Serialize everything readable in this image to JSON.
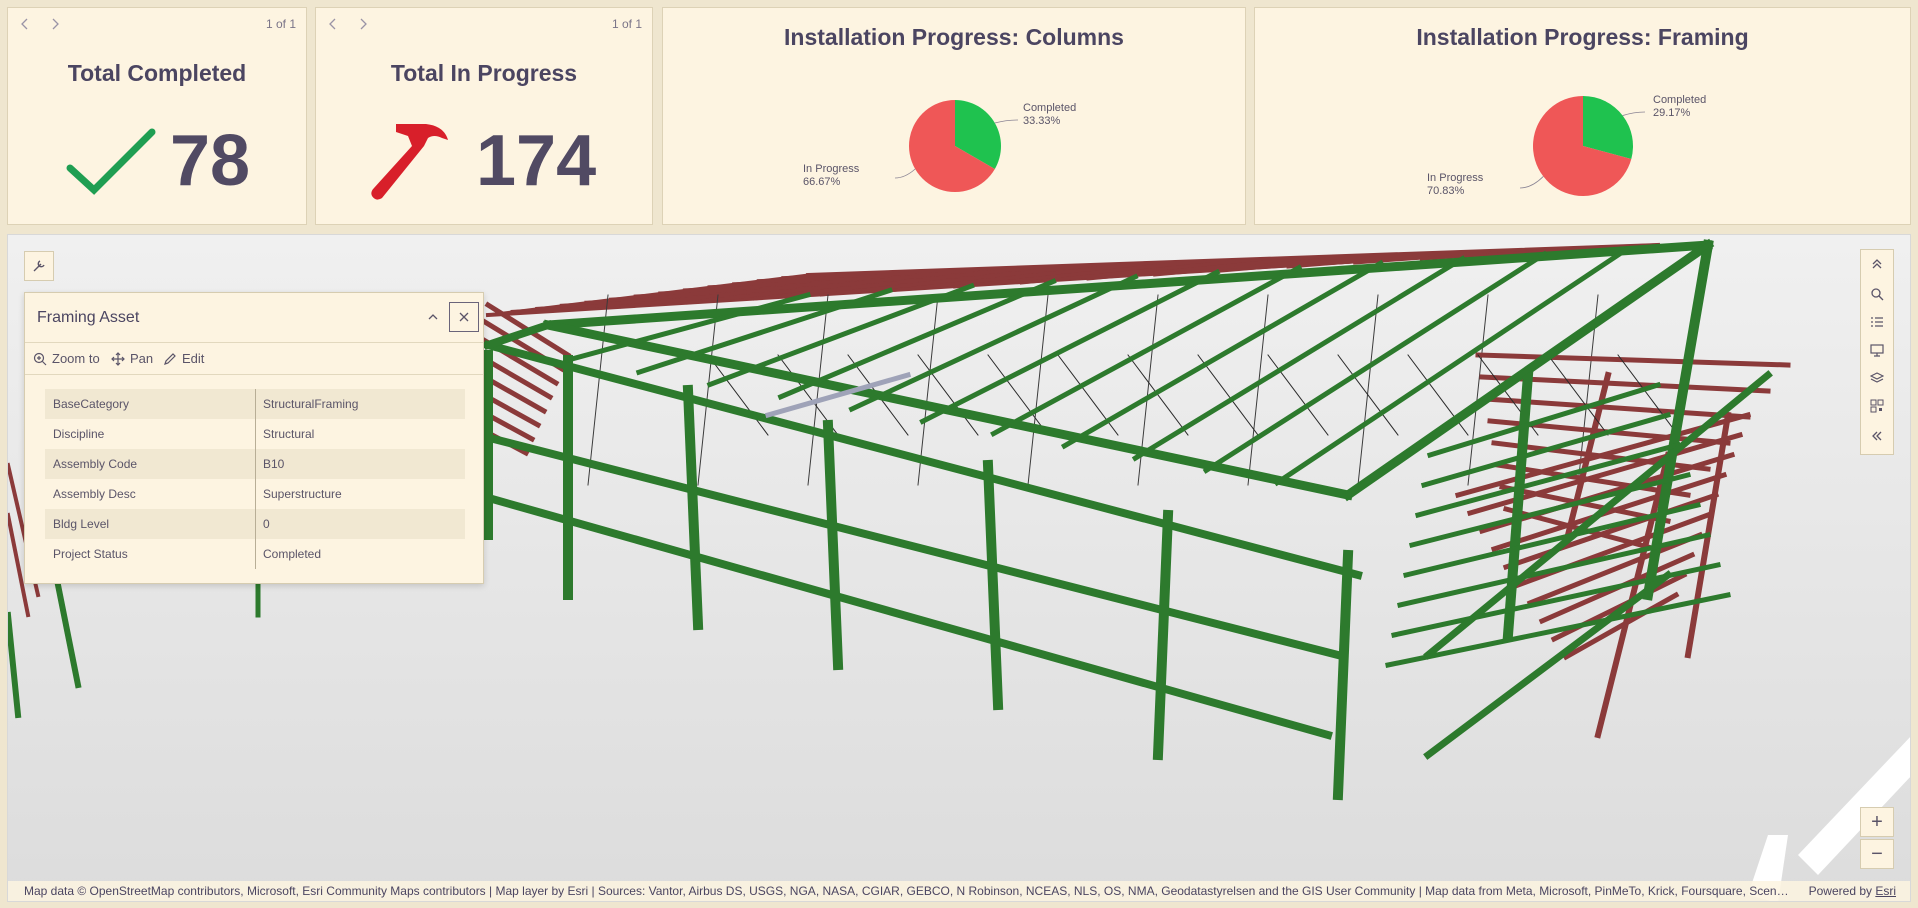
{
  "indicators": [
    {
      "pager": "1 of 1",
      "title": "Total Completed",
      "value": "78",
      "icon": "checkmark-icon",
      "icon_color": "#1f9e52"
    },
    {
      "pager": "1 of 1",
      "title": "Total In Progress",
      "value": "174",
      "icon": "hammer-icon",
      "icon_color": "#d81f2a"
    }
  ],
  "chart_data": [
    {
      "type": "pie",
      "title": "Installation Progress: Columns",
      "slices": [
        {
          "label": "Completed",
          "value": 33.33,
          "display": "33.33%",
          "color": "#1fc24f"
        },
        {
          "label": "In Progress",
          "value": 66.67,
          "display": "66.67%",
          "color": "#ef5757"
        }
      ]
    },
    {
      "type": "pie",
      "title": "Installation Progress: Framing",
      "slices": [
        {
          "label": "Completed",
          "value": 29.17,
          "display": "29.17%",
          "color": "#1fc24f"
        },
        {
          "label": "In Progress",
          "value": 70.83,
          "display": "70.83%",
          "color": "#ef5757"
        }
      ]
    }
  ],
  "popup": {
    "title": "Framing Asset",
    "actions": {
      "zoom": "Zoom to",
      "pan": "Pan",
      "edit": "Edit"
    },
    "rows": [
      {
        "key": "BaseCategory",
        "value": "StructuralFraming"
      },
      {
        "key": "Discipline",
        "value": "Structural"
      },
      {
        "key": "Assembly Code",
        "value": "B10"
      },
      {
        "key": "Assembly Desc",
        "value": "Superstructure"
      },
      {
        "key": "Bldg Level",
        "value": "0"
      },
      {
        "key": "Project Status",
        "value": "Completed"
      }
    ]
  },
  "map": {
    "zoom_in": "+",
    "zoom_out": "−",
    "attribution": "Map data © OpenStreetMap contributors, Microsoft, Esri Community Maps contributors | Map layer by Esri | Sources: Vantor, Airbus DS, USGS, NGA, NASA, CGIAR, GEBCO, N Robinson, NCEAS, NLS, OS, NMA, Geodatastyrelsen and the GIS User Community | Map data from Meta, Microsoft, PinMeTo, Krick, Foursquare, Scene la…",
    "powered_by": "Powered by ",
    "powered_brand": "Esri",
    "completed_color": "#2d7a2d",
    "in_progress_color": "#8b3a3a"
  }
}
